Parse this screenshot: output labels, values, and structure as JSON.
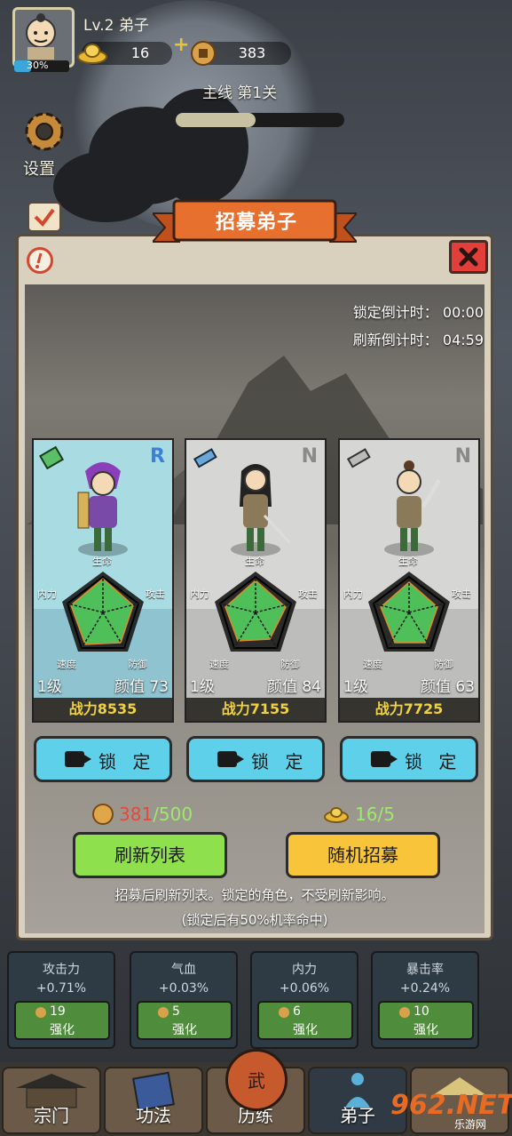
{
  "player": {
    "level_text": "Lv.2 弟子",
    "exp_percent_text": "30%",
    "exp_fraction": 0.3,
    "gold": "16",
    "coins": "383"
  },
  "side": {
    "settings_label": "设置"
  },
  "stage": {
    "label": "主线 第1关"
  },
  "dialog": {
    "title": "招募弟子",
    "lock_timer": "锁定倒计时：  00:00",
    "refresh_timer": "刷新倒计时：  04:59",
    "cards": [
      {
        "grade": "R",
        "level": "1级",
        "beauty": "颜值 73",
        "power": "战力8535",
        "stat_top": "生命",
        "stat_left": "内力",
        "stat_right": "攻击",
        "stat_bl": "速度",
        "stat_br": "防御",
        "bg_upper": "#a9dbe3",
        "bg_lower": "#8ec3cf",
        "grade_color": "#3e7fd8"
      },
      {
        "grade": "N",
        "level": "1级",
        "beauty": "颜值 84",
        "power": "战力7155",
        "stat_top": "生命",
        "stat_left": "内力",
        "stat_right": "攻击",
        "stat_bl": "速度",
        "stat_br": "防御",
        "bg_upper": "#d6d6d4",
        "bg_lower": "#bdbdbb",
        "grade_color": "#8a8a8a"
      },
      {
        "grade": "N",
        "level": "1级",
        "beauty": "颜值 63",
        "power": "战力7725",
        "stat_top": "生命",
        "stat_left": "内力",
        "stat_right": "攻击",
        "stat_bl": "速度",
        "stat_br": "防御",
        "bg_upper": "#d6d6d4",
        "bg_lower": "#bdbdbb",
        "grade_color": "#8a8a8a"
      }
    ],
    "lock_label": "锁 定",
    "refresh_cost": "381",
    "refresh_cost_total": "/500",
    "recruit_cost": "16/5",
    "refresh_button": "刷新列表",
    "recruit_button": "随机招募",
    "note_line1": "招募后刷新列表。锁定的角色，不受刷新影响。",
    "note_line2": "(锁定后有50%机率命中)"
  },
  "stats": [
    {
      "name": "攻击力",
      "pct": "+0.71%",
      "cost": "19",
      "label": "强化"
    },
    {
      "name": "气血",
      "pct": "+0.03%",
      "cost": "5",
      "label": "强化"
    },
    {
      "name": "内力",
      "pct": "+0.06%",
      "cost": "6",
      "label": "强化"
    },
    {
      "name": "暴击率",
      "pct": "+0.24%",
      "cost": "10",
      "label": "强化"
    }
  ],
  "nav": {
    "tab1": "宗门",
    "tab2": "功法",
    "tab3": "历练",
    "tab4": "弟子",
    "drum_char": "武"
  },
  "watermark": {
    "brand": "962.NET",
    "sub": "乐游网"
  },
  "colors": {
    "lock_button": "#5ed0ea",
    "refresh_button": "#8fe04d",
    "recruit_button": "#f7c43a",
    "power_text": "#f2d23c",
    "close_button": "#e23e3a",
    "ribbon": "#e8702f",
    "radar_fill": "#4fbf5a"
  }
}
